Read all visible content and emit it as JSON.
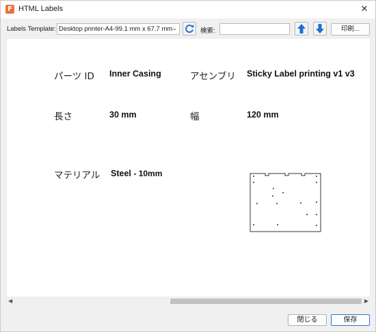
{
  "window": {
    "title": "HTML Labels",
    "app_icon_letter": "F",
    "close_glyph": "✕"
  },
  "toolbar": {
    "template_label": "Labels Template:",
    "template_value": "Desktop printer-A4-99.1 mm x 67.7 mm",
    "search_label": "検索:",
    "search_placeholder": "",
    "print_label": "印刷..."
  },
  "label": {
    "part_id_label": "パーツ ID",
    "part_id_value": "Inner Casing",
    "assembly_label": "アセンブリ",
    "assembly_value": "Sticky Label printing v1 v3",
    "length_label": "長さ",
    "length_value": "30 mm",
    "width_label": "幅",
    "width_value": "120 mm",
    "material_label": "マテリアル",
    "material_value": "Steel",
    "material_suffix": "- 10mm"
  },
  "footer": {
    "close_label": "閉じる",
    "save_label": "保存"
  },
  "icons": {
    "refresh": "refresh-icon",
    "up": "arrow-up-icon",
    "down": "arrow-down-icon"
  },
  "colors": {
    "accent": "#1e6fd6",
    "app_icon": "#e8733a"
  }
}
